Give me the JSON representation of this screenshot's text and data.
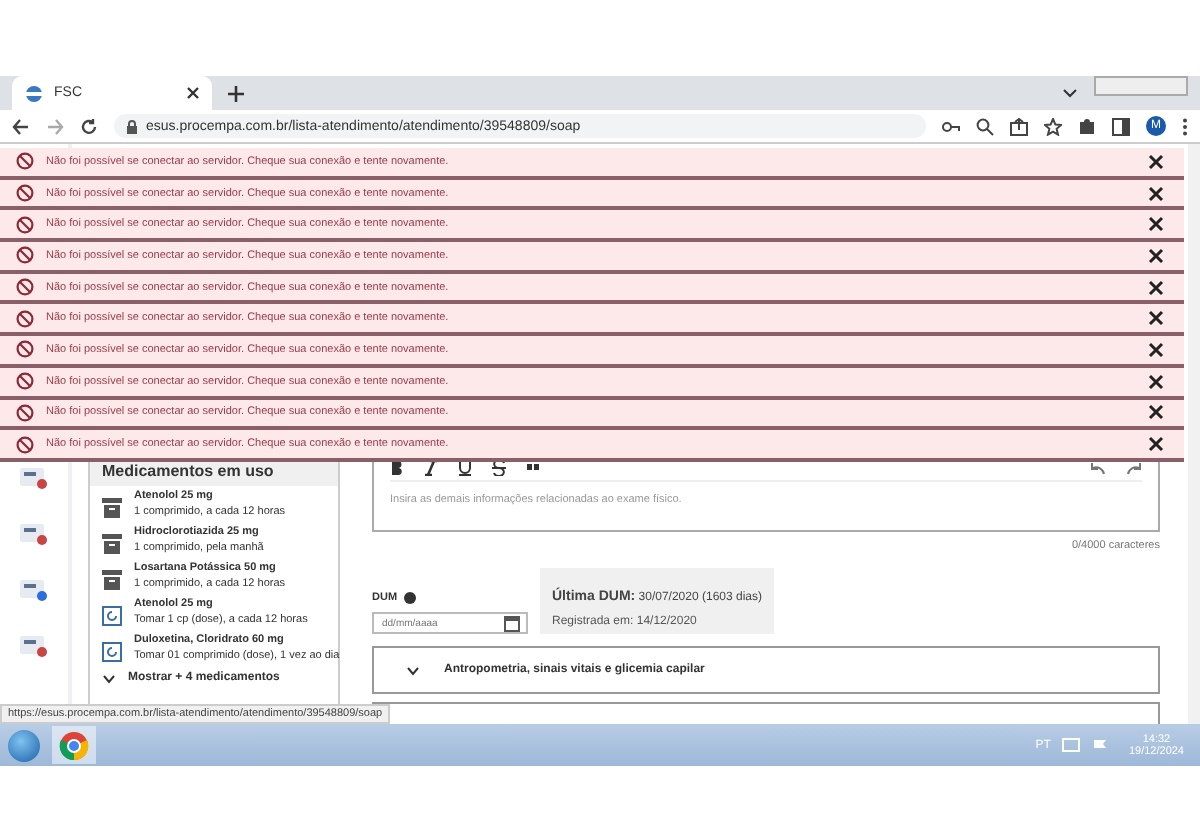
{
  "browser": {
    "tab_title": "FSC",
    "url": "esus.procempa.com.br/lista-atendimento/atendimento/39548809/soap",
    "avatar": "M"
  },
  "alerts": [
    {
      "message": "Não foi possível se conectar ao servidor. Cheque sua conexão e tente novamente."
    },
    {
      "message": "Não foi possível se conectar ao servidor. Cheque sua conexão e tente novamente."
    },
    {
      "message": "Não foi possível se conectar ao servidor. Cheque sua conexão e tente novamente."
    },
    {
      "message": "Não foi possível se conectar ao servidor. Cheque sua conexão e tente novamente."
    },
    {
      "message": "Não foi possível se conectar ao servidor. Cheque sua conexão e tente novamente."
    },
    {
      "message": "Não foi possível se conectar ao servidor. Cheque sua conexão e tente novamente."
    },
    {
      "message": "Não foi possível se conectar ao servidor. Cheque sua conexão e tente novamente."
    },
    {
      "message": "Não foi possível se conectar ao servidor. Cheque sua conexão e tente novamente."
    },
    {
      "message": "Não foi possível se conectar ao servidor. Cheque sua conexão e tente novamente."
    },
    {
      "message": "Não foi possível se conectar ao servidor. Cheque sua conexão e tente novamente."
    }
  ],
  "medications": {
    "title": "Medicamentos em uso",
    "items": [
      {
        "name": "Atenolol 25 mg",
        "dosage": "1 comprimido, a cada 12 horas",
        "kind": "archived"
      },
      {
        "name": "Hidroclorotiazida 25 mg",
        "dosage": "1 comprimido, pela manhã",
        "kind": "archived"
      },
      {
        "name": "Losartana Potássica 50 mg",
        "dosage": "1 comprimido, a cada 12 horas",
        "kind": "archived"
      },
      {
        "name": "Atenolol 25 mg",
        "dosage": "Tomar 1 cp (dose), a cada 12 horas",
        "kind": "renew"
      },
      {
        "name": "Duloxetina, Cloridrato 60 mg",
        "dosage": "Tomar 01 comprimido (dose), 1 vez ao dia",
        "kind": "renew"
      }
    ],
    "show_more": "Mostrar + 4 medicamentos"
  },
  "editor": {
    "placeholder": "Insira as demais informações relacionadas ao exame físico.",
    "counter": "0/4000 caracteres"
  },
  "dum": {
    "label": "DUM",
    "placeholder": "dd/mm/aaaa",
    "last_label": "Última DUM:",
    "last_value": "30/07/2020 (1603 dias)",
    "registered": "Registrada em: 14/12/2020"
  },
  "section": {
    "title": "Antropometria, sinais vitais e glicemia capilar",
    "expanded": false
  },
  "status_url": "https://esus.procempa.com.br/lista-atendimento/atendimento/39548809/soap",
  "taskbar": {
    "language": "PT",
    "time": "14:32",
    "date": "19/12/2024"
  }
}
